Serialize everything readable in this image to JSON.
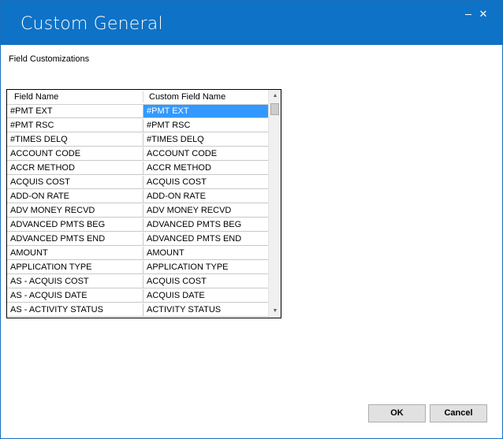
{
  "window": {
    "title": "Custom General",
    "minimize_icon": "minimize-icon",
    "close_icon": "close-icon"
  },
  "section_label": "Field Customizations",
  "grid": {
    "columns": [
      "Field Name",
      "Custom Field Name"
    ],
    "selected_row": 0,
    "rows": [
      {
        "field": "#PMT EXT",
        "custom": "#PMT EXT"
      },
      {
        "field": "#PMT RSC",
        "custom": "#PMT RSC"
      },
      {
        "field": "#TIMES DELQ",
        "custom": "#TIMES DELQ"
      },
      {
        "field": "ACCOUNT CODE",
        "custom": "ACCOUNT CODE"
      },
      {
        "field": "ACCR METHOD",
        "custom": "ACCR METHOD"
      },
      {
        "field": "ACQUIS COST",
        "custom": "ACQUIS COST"
      },
      {
        "field": "ADD-ON RATE",
        "custom": "ADD-ON RATE"
      },
      {
        "field": "ADV MONEY RECVD",
        "custom": "ADV MONEY RECVD"
      },
      {
        "field": "ADVANCED PMTS BEG",
        "custom": "ADVANCED PMTS BEG"
      },
      {
        "field": "ADVANCED PMTS END",
        "custom": "ADVANCED PMTS END"
      },
      {
        "field": "AMOUNT",
        "custom": "AMOUNT"
      },
      {
        "field": "APPLICATION TYPE",
        "custom": "APPLICATION TYPE"
      },
      {
        "field": "AS   - ACQUIS COST",
        "custom": "ACQUIS COST"
      },
      {
        "field": "AS   - ACQUIS DATE",
        "custom": "ACQUIS DATE"
      },
      {
        "field": "AS   - ACTIVITY STATUS",
        "custom": "ACTIVITY STATUS"
      }
    ]
  },
  "buttons": {
    "ok": "OK",
    "cancel": "Cancel"
  }
}
